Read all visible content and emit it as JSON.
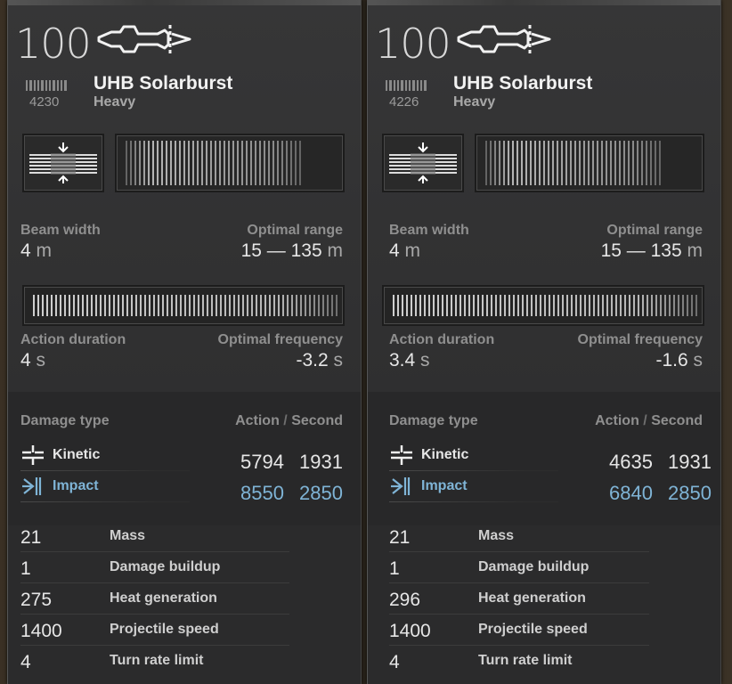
{
  "cards": [
    {
      "level": "100",
      "code": "4230",
      "name": "UHB Solarburst",
      "class": "Heavy",
      "beam_width": {
        "label": "Beam width",
        "value": "4",
        "unit": "m"
      },
      "optimal_range": {
        "label": "Optimal range",
        "value": "15 — 135",
        "unit": "m"
      },
      "action_duration": {
        "label": "Action duration",
        "value": "4",
        "unit": "s"
      },
      "optimal_frequency": {
        "label": "Optimal frequency",
        "value": "-3.2",
        "unit": "s"
      },
      "damage": {
        "header": "Damage type",
        "col_action": "Action",
        "col_sep": "/",
        "col_second": "Second",
        "rows": [
          {
            "label": "Kinetic",
            "action": "5794",
            "second": "1931"
          },
          {
            "label": "Impact",
            "action": "8550",
            "second": "2850"
          }
        ]
      },
      "stats": [
        {
          "value": "21",
          "label": "Mass"
        },
        {
          "value": "1",
          "label": "Damage buildup"
        },
        {
          "value": "275",
          "label": "Heat generation"
        },
        {
          "value": "1400",
          "label": "Projectile speed"
        },
        {
          "value": "4",
          "label": "Turn rate limit"
        }
      ]
    },
    {
      "level": "100",
      "code": "4226",
      "name": "UHB Solarburst",
      "class": "Heavy",
      "beam_width": {
        "label": "Beam width",
        "value": "4",
        "unit": "m"
      },
      "optimal_range": {
        "label": "Optimal range",
        "value": "15 — 135",
        "unit": "m"
      },
      "action_duration": {
        "label": "Action duration",
        "value": "3.4",
        "unit": "s"
      },
      "optimal_frequency": {
        "label": "Optimal frequency",
        "value": "-1.6",
        "unit": "s"
      },
      "damage": {
        "header": "Damage type",
        "col_action": "Action",
        "col_sep": "/",
        "col_second": "Second",
        "rows": [
          {
            "label": "Kinetic",
            "action": "4635",
            "second": "1931"
          },
          {
            "label": "Impact",
            "action": "6840",
            "second": "2850"
          }
        ]
      },
      "stats": [
        {
          "value": "21",
          "label": "Mass"
        },
        {
          "value": "1",
          "label": "Damage buildup"
        },
        {
          "value": "296",
          "label": "Heat generation"
        },
        {
          "value": "1400",
          "label": "Projectile speed"
        },
        {
          "value": "4",
          "label": "Turn rate limit"
        }
      ]
    }
  ],
  "icons": {
    "weapon": "beam-weapon-icon",
    "kinetic": "kinetic-icon",
    "impact": "impact-icon",
    "beam_width": "beam-width-icon"
  },
  "colors": {
    "impact": "#7fb4d6",
    "kinetic": "#e6e6e6"
  }
}
